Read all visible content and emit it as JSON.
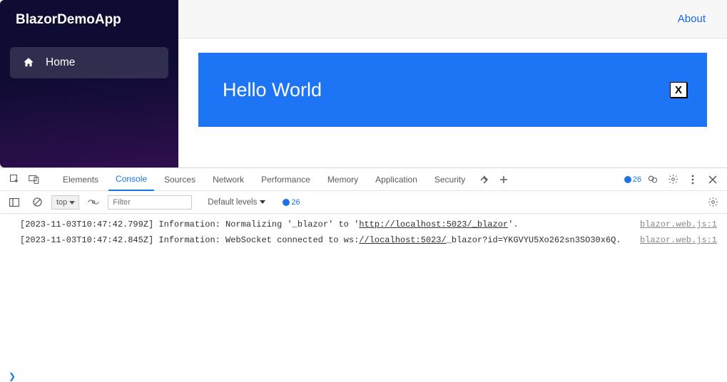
{
  "sidebar": {
    "brand": "BlazorDemoApp",
    "items": [
      {
        "label": "Home",
        "icon": "home-icon"
      }
    ]
  },
  "topbar": {
    "about": "About"
  },
  "banner": {
    "title": "Hello World",
    "close": "X"
  },
  "devtools": {
    "tabs": [
      "Elements",
      "Console",
      "Sources",
      "Network",
      "Performance",
      "Memory",
      "Application",
      "Security"
    ],
    "activeTab": "Console",
    "issueCount": "26",
    "filterBar": {
      "context": "top",
      "filterPlaceholder": "Filter",
      "levels": "Default levels",
      "issueCount": "26"
    },
    "log": [
      {
        "ts": "[2023-11-03T10:47:42.799Z]",
        "rest": " Information: Normalizing '_blazor' to '",
        "link": "http://localhost:5023/_blazor",
        "after": "'.",
        "src": "blazor.web.js:1"
      },
      {
        "ts": "[2023-11-03T10:47:42.845Z]",
        "rest": " Information: WebSocket connected to ws:",
        "link": "//localhost:5023/",
        "after": "_blazor?id=YKGVYU5Xo262sn3SO30x6Q.",
        "src": "blazor.web.js:1"
      }
    ]
  }
}
